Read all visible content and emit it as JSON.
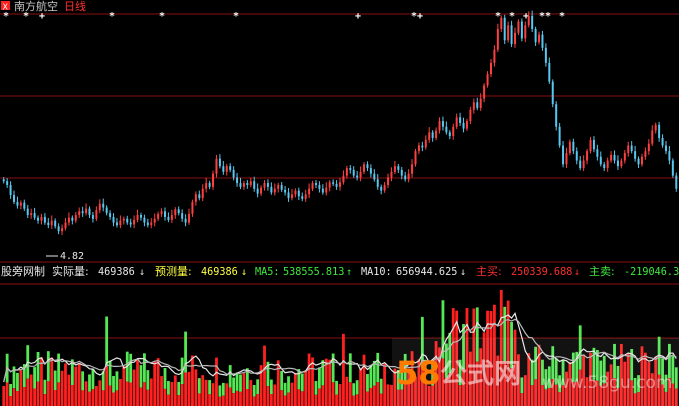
{
  "header": {
    "x_box": "X",
    "stock_name": "南方航空",
    "period": "日线"
  },
  "marks": [
    "*",
    "*",
    "+",
    "*",
    "*",
    "*",
    "+",
    "*",
    "+",
    "*",
    "*",
    "+",
    "*",
    "*",
    "*"
  ],
  "min_label": "4.82",
  "stats_bar": {
    "title": "股旁网制",
    "actual_label": "实际量:",
    "actual_value": "469386",
    "actual_arrow": "↓",
    "forecast_label": "预测量:",
    "forecast_value": "469386",
    "forecast_arrow": "↓",
    "ma5_label": "MA5:",
    "ma5_value": "538555.813",
    "ma5_arrow": "↑",
    "ma10_label": "MA10:",
    "ma10_value": "656944.625",
    "ma10_arrow": "↓",
    "buy_label": "主买:",
    "buy_value": "250339.688",
    "buy_arrow": "↓",
    "sell_label": "主卖:",
    "sell_value": "-219046.3"
  },
  "watermark": {
    "logo_num": "58",
    "logo_text": "公式网",
    "url": "www.58gu.com"
  },
  "colors": {
    "up": "#ff4040",
    "down": "#58c8f0",
    "neutral": "#e8e8e8",
    "vol_up": "#ff2020",
    "vol_down": "#54e854",
    "grid": "#8a1010",
    "ma": "#e8e8e8",
    "label_white": "#e8e8e8",
    "label_yellow": "#ffff40",
    "label_green": "#40e840",
    "label_red": "#ff3030",
    "watermark_orange": "#ff7a00"
  },
  "chart_data": [
    {
      "type": "candlestick",
      "title": "南方航空 日线",
      "ylim": [
        4.0,
        10.6
      ],
      "grid": true,
      "min_marker": 4.82,
      "closes": [
        6.15,
        6.05,
        5.78,
        5.6,
        5.5,
        5.58,
        5.42,
        5.25,
        5.3,
        5.18,
        5.1,
        5.2,
        5.05,
        4.98,
        5.1,
        4.95,
        4.82,
        4.9,
        5.05,
        5.18,
        5.1,
        5.25,
        5.35,
        5.3,
        5.42,
        5.25,
        5.15,
        5.38,
        5.55,
        5.45,
        5.3,
        5.2,
        5.05,
        4.98,
        5.1,
        5.15,
        5.05,
        5.0,
        5.12,
        5.25,
        5.18,
        5.05,
        4.98,
        5.05,
        5.15,
        5.28,
        5.35,
        5.2,
        5.12,
        5.25,
        5.4,
        5.3,
        5.15,
        5.05,
        5.28,
        5.6,
        5.8,
        5.7,
        5.95,
        6.1,
        6.0,
        6.35,
        6.75,
        6.55,
        6.4,
        6.55,
        6.45,
        6.25,
        6.1,
        6.0,
        6.1,
        6.05,
        6.15,
        5.95,
        5.82,
        5.98,
        6.1,
        6.0,
        5.85,
        5.95,
        6.05,
        5.92,
        5.85,
        5.7,
        5.8,
        5.9,
        5.75,
        5.68,
        5.8,
        5.95,
        6.1,
        6.05,
        5.95,
        5.85,
        5.98,
        6.12,
        6.08,
        6.0,
        6.12,
        6.3,
        6.5,
        6.45,
        6.3,
        6.25,
        6.4,
        6.6,
        6.5,
        6.35,
        6.2,
        6.0,
        5.9,
        6.05,
        6.25,
        6.4,
        6.55,
        6.45,
        6.3,
        6.2,
        6.35,
        6.6,
        6.95,
        7.1,
        7.05,
        7.25,
        7.45,
        7.3,
        7.5,
        7.75,
        7.6,
        7.45,
        7.35,
        7.6,
        7.85,
        7.7,
        7.55,
        7.75,
        8.05,
        8.25,
        8.1,
        8.35,
        8.7,
        9.0,
        9.3,
        9.65,
        10.2,
        10.5,
        9.9,
        10.3,
        9.8,
        10.1,
        10.4,
        9.95,
        10.3,
        10.55,
        10.2,
        9.85,
        10.05,
        9.7,
        9.3,
        8.8,
        8.2,
        7.6,
        7.1,
        6.6,
        6.9,
        7.2,
        6.95,
        6.7,
        6.5,
        6.7,
        6.95,
        7.25,
        7.0,
        6.8,
        6.6,
        6.5,
        6.7,
        6.85,
        6.7,
        6.55,
        6.7,
        6.9,
        7.1,
        6.95,
        6.75,
        6.6,
        6.8,
        6.95,
        7.15,
        7.5,
        7.65,
        7.3,
        7.1,
        6.95,
        6.7,
        6.3,
        5.95
      ]
    },
    {
      "type": "bar",
      "title": "股旁网制",
      "series": [
        {
          "name": "实际量",
          "values": [
            469386
          ]
        },
        {
          "name": "预测量",
          "values": [
            469386
          ]
        },
        {
          "name": "MA5",
          "values": [
            538555.813
          ]
        },
        {
          "name": "MA10",
          "values": [
            656944.625
          ]
        },
        {
          "name": "主买",
          "values": [
            250339.688
          ]
        },
        {
          "name": "主卖",
          "values": [
            -219046.3
          ]
        }
      ]
    }
  ]
}
